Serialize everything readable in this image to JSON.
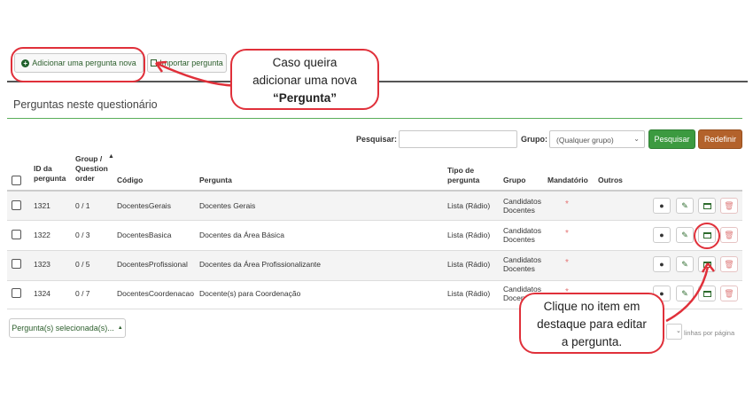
{
  "toolbar": {
    "add_label": "Adicionar uma pergunta nova",
    "import_label": "Importar pergunta"
  },
  "section_title": "Perguntas neste questionário",
  "search": {
    "label": "Pesquisar:",
    "value": "",
    "group_label": "Grupo:",
    "group_value": "(Qualquer grupo)",
    "search_button": "Pesquisar",
    "reset_button": "Redefinir"
  },
  "table": {
    "headers": {
      "id": "ID da pergunta",
      "group_order": "Group / Question order",
      "code": "Código",
      "question": "Pergunta",
      "type": "Tipo de pergunta",
      "group": "Grupo",
      "mandatory": "Mandatório",
      "other": "Outros"
    },
    "rows": [
      {
        "id": "1321",
        "order": "0 / 1",
        "code": "DocentesGerais",
        "question": "Docentes Gerais",
        "type": "Lista (Rádio)",
        "group": "Candidatos Docentes",
        "mandatory": "*"
      },
      {
        "id": "1322",
        "order": "0 / 3",
        "code": "DocentesBasica",
        "question": "Docentes da Área Básica",
        "type": "Lista (Rádio)",
        "group": "Candidatos Docentes",
        "mandatory": "*"
      },
      {
        "id": "1323",
        "order": "0 / 5",
        "code": "DocentesProfissional",
        "question": "Docentes da Área Profissionalizante",
        "type": "Lista (Rádio)",
        "group": "Candidatos Docentes",
        "mandatory": "*"
      },
      {
        "id": "1324",
        "order": "0 / 7",
        "code": "DocentesCoordenacao",
        "question": "Docente(s) para Coordenação",
        "type": "Lista (Rádio)",
        "group": "Candidatos Docentes",
        "mandatory": "*"
      }
    ]
  },
  "footer": {
    "selected_label": "Pergunta(s) selecionada(s)...",
    "per_page_label": "linhas por página"
  },
  "annotations": {
    "callout_top_line1": "Caso queira",
    "callout_top_line2": "adicionar uma nova",
    "callout_top_bold": "“Pergunta”",
    "callout_bottom_line1": "Clique no item em",
    "callout_bottom_line2": "destaque para editar",
    "callout_bottom_line3": "a pergunta."
  },
  "colors": {
    "annotation": "#e0303a",
    "primary_green": "#3c9a40",
    "reset_brown": "#b3622b"
  }
}
